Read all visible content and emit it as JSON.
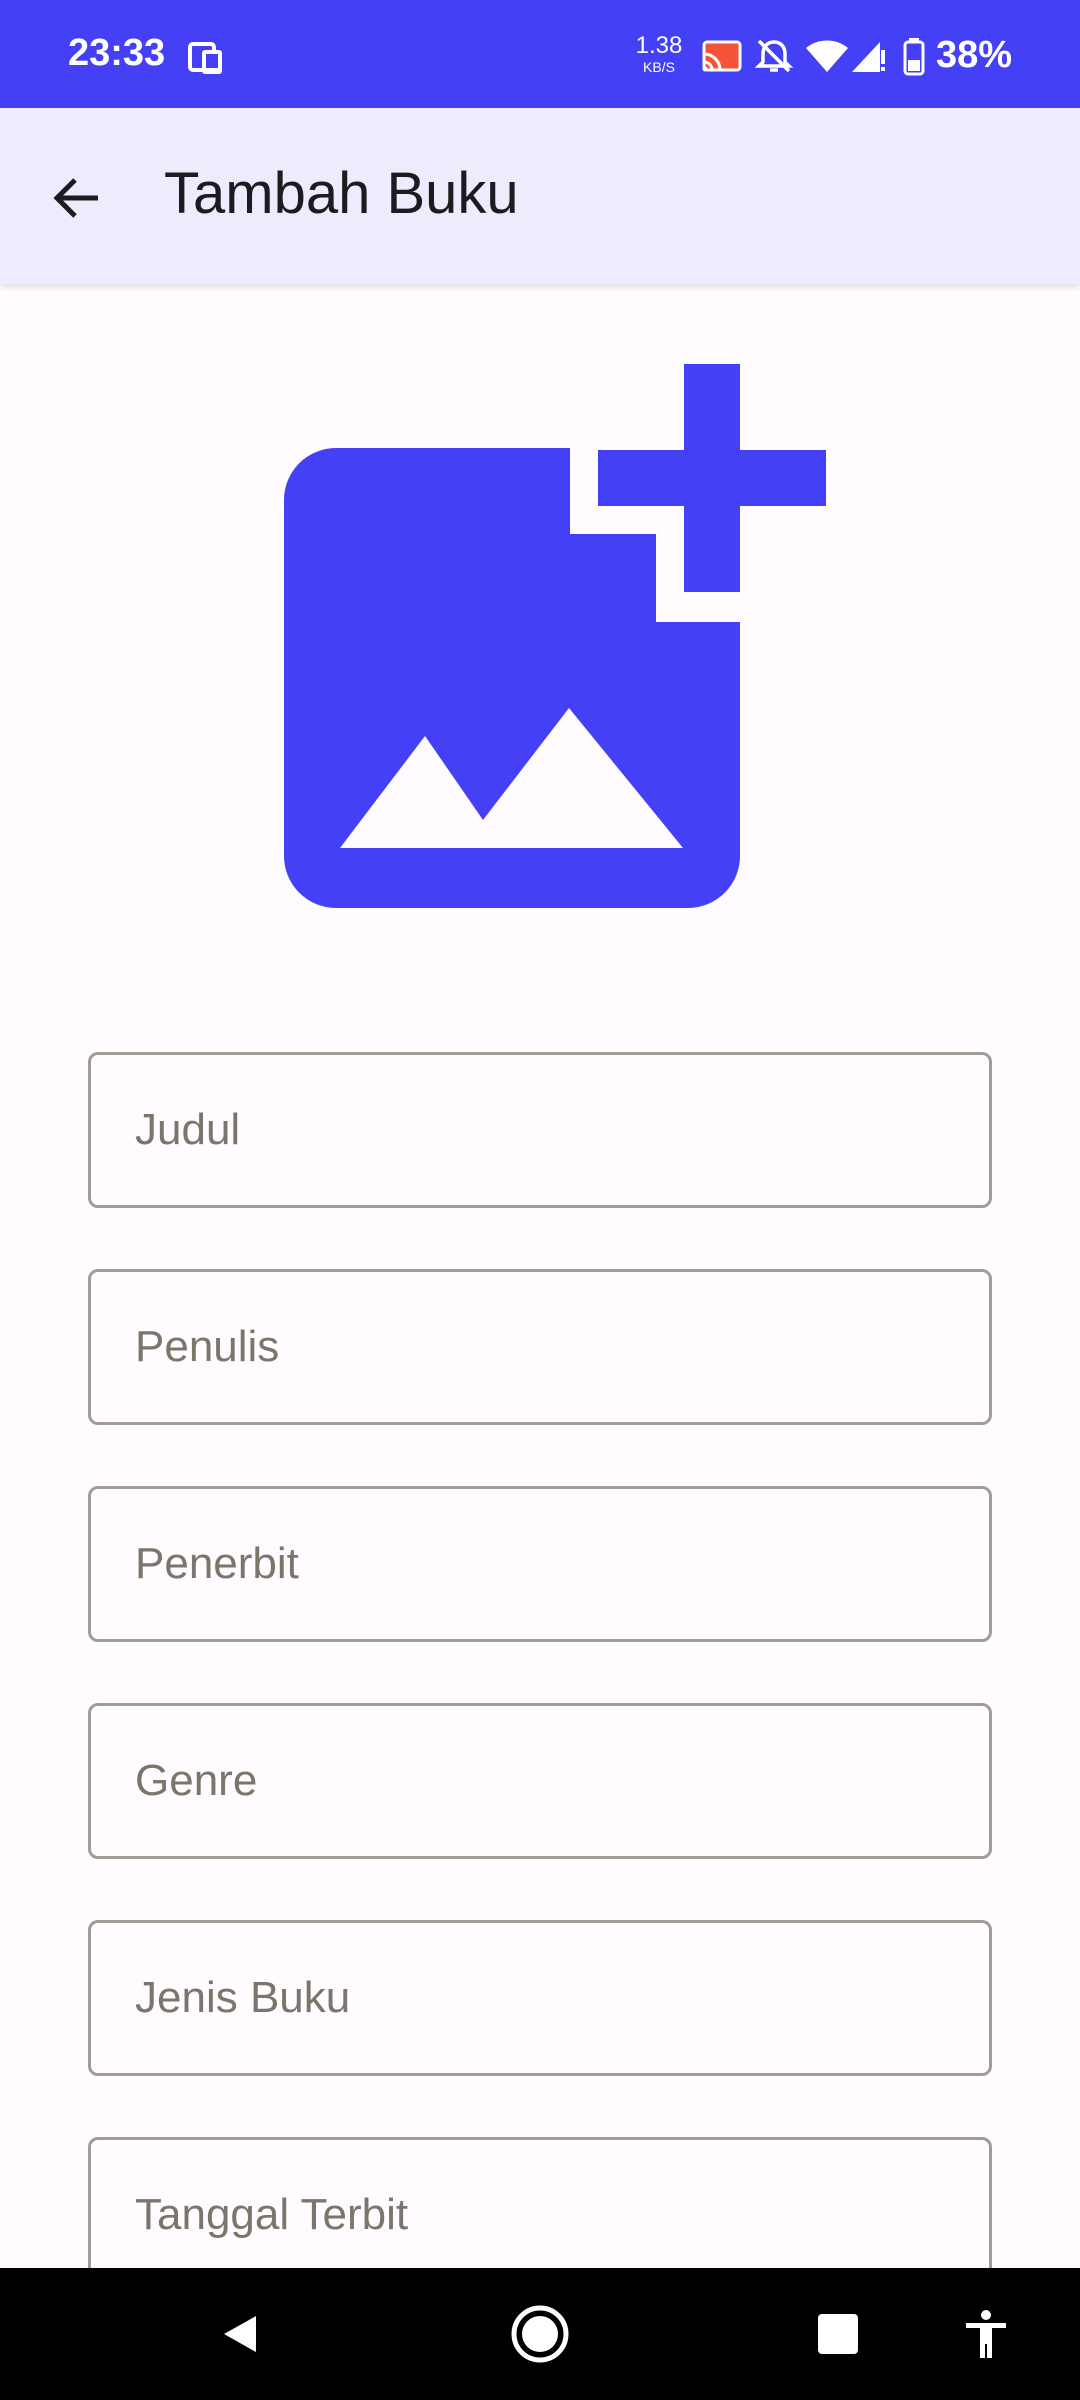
{
  "status_bar": {
    "time": "23:33",
    "net_speed_value": "1.38",
    "net_speed_unit": "KB/S",
    "battery_percent": "38%",
    "background_color": "#4340F5",
    "icons": [
      "phone-sync-icon",
      "cast-icon",
      "notifications-off-icon",
      "wifi-icon",
      "cell-signal-icon",
      "battery-icon"
    ]
  },
  "app_bar": {
    "title": "Tambah Buku",
    "back_icon": "arrow-back-icon",
    "background_color": "#EDEBFC"
  },
  "image_picker": {
    "icon": "add-photo-icon",
    "color": "#4340F5"
  },
  "form": {
    "fields": [
      {
        "placeholder": "Judul",
        "value": ""
      },
      {
        "placeholder": "Penulis",
        "value": ""
      },
      {
        "placeholder": "Penerbit",
        "value": ""
      },
      {
        "placeholder": "Genre",
        "value": ""
      },
      {
        "placeholder": "Jenis Buku",
        "value": ""
      },
      {
        "placeholder": "Tanggal Terbit",
        "value": ""
      }
    ]
  },
  "nav_bar": {
    "buttons": [
      "back-triangle-icon",
      "home-circle-icon",
      "recents-square-icon",
      "accessibility-icon"
    ]
  }
}
